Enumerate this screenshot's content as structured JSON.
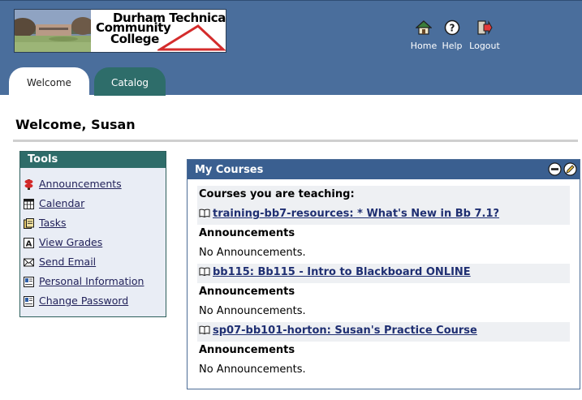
{
  "header": {
    "logo": {
      "line1": "Durham Technical",
      "line2": "Community",
      "line3": "College"
    },
    "nav": [
      {
        "label": "Home",
        "icon": "home-icon"
      },
      {
        "label": "Help",
        "icon": "help-icon"
      },
      {
        "label": "Logout",
        "icon": "logout-icon"
      }
    ],
    "tabs": [
      {
        "label": "Welcome",
        "active": true
      },
      {
        "label": "Catalog",
        "active": false
      }
    ]
  },
  "page": {
    "title": "Welcome, Susan"
  },
  "tools": {
    "title": "Tools",
    "items": [
      {
        "label": "Announcements",
        "icon": "announcements-icon"
      },
      {
        "label": "Calendar",
        "icon": "calendar-icon"
      },
      {
        "label": "Tasks",
        "icon": "tasks-icon"
      },
      {
        "label": "View Grades",
        "icon": "grades-icon"
      },
      {
        "label": "Send Email",
        "icon": "email-icon"
      },
      {
        "label": "Personal Information",
        "icon": "personal-info-icon"
      },
      {
        "label": "Change Password",
        "icon": "password-icon"
      }
    ]
  },
  "my_courses": {
    "title": "My Courses",
    "intro": "Courses you are teaching:",
    "courses": [
      {
        "name": "training-bb7-resources: * What's New in Bb 7.1?",
        "announcements_heading": "Announcements",
        "announcements_text": "No Announcements."
      },
      {
        "name": "bb115: Bb115 - Intro to Blackboard ONLINE",
        "announcements_heading": "Announcements",
        "announcements_text": "No Announcements."
      },
      {
        "name": "sp07-bb101-horton: Susan's Practice Course",
        "announcements_heading": "Announcements",
        "announcements_text": "No Announcements."
      }
    ]
  },
  "colors": {
    "header_bg": "#4a6e9c",
    "tab_inactive": "#2e6d6a",
    "tools_header": "#2e6c69",
    "courses_header": "#3a5f90",
    "link": "#1f2f72"
  }
}
